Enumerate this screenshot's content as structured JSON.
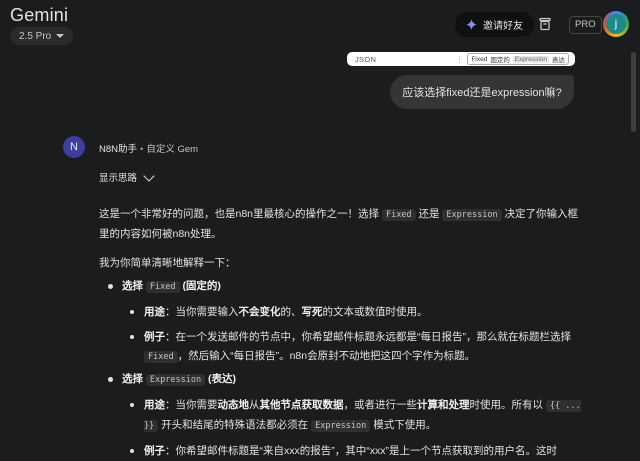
{
  "header": {
    "app_title": "Gemini",
    "model": "2.5 Pro",
    "invite_label": "邀请好友",
    "pro_badge": "PRO",
    "avatar_letter": "j"
  },
  "attachment": {
    "left_label": "JSON",
    "chip_a": "Fixed",
    "chip_a_sub": "固定的",
    "chip_b": "Expression",
    "chip_b_sub": "表达"
  },
  "user_message": "应该选择fixed还是expression嘛?",
  "gem": {
    "avatar_letter": "N",
    "name": "N8N助手",
    "separator": "•",
    "subtitle": "自定义 Gem",
    "show_thoughts": "显示思路"
  },
  "answer": {
    "p1_a": "这是一个非常好的问题，也是n8n里最核心的操作之一！选择",
    "p1_code1": "Fixed",
    "p1_b": "还是",
    "p1_code2": "Expression",
    "p1_c": "决定了你输入框里的内容如何被n8n处理。",
    "p2": "我为你简单清晰地解释一下：",
    "item1": {
      "lead": "选择",
      "code": "Fixed",
      "title": "(固定的)",
      "usage_label": "用途",
      "usage_a": "：当你需要输入",
      "usage_bold1": "不会变化",
      "usage_b": "的、",
      "usage_bold2": "写死",
      "usage_c": "的文本或数值时使用。",
      "example_label": "例子",
      "example_a": "：在一个发送邮件的节点中，你希望邮件标题永远都是“每日报告”，那么就在标题栏选择",
      "example_code": "Fixed",
      "example_b": "，然后输入“每日报告”。n8n会原封不动地把这四个字作为标题。"
    },
    "item2": {
      "lead": "选择",
      "code": "Expression",
      "title": "(表达)",
      "usage_label": "用途",
      "usage_a": "：当你需要",
      "usage_bold1": "动态地",
      "usage_b": "从",
      "usage_bold2": "其他节点获取数据",
      "usage_c": "，或者进行一些",
      "usage_bold3": "计算和处理",
      "usage_d": "时使用。所有以",
      "usage_code1": "{{ ... }}",
      "usage_e": "开头和结尾的特殊语法都必须在",
      "usage_code2": "Expression",
      "usage_f": "模式下使用。",
      "example_label": "例子",
      "example_a": "：你希望邮件标题是“来自xxx的报告”，其中“xxx”是上一个节点获取到的用户名。这时"
    }
  },
  "colors": {
    "background": "#1b1c1d",
    "bubble": "#333537",
    "gem_avatar": "#3c3f9e",
    "code_bg": "#2d2f31"
  }
}
